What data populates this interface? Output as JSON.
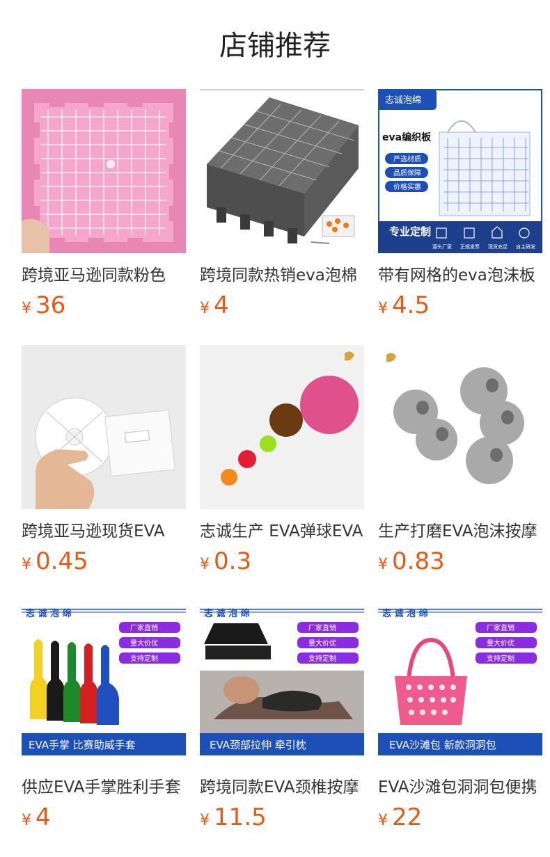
{
  "section_title": "店铺推荐",
  "currency_symbol": "¥",
  "products": [
    {
      "name": "跨境亚马逊同款粉色",
      "price": "36",
      "image": "pink-eva-grid-mat"
    },
    {
      "name": "跨境同款热销eva泡棉",
      "price": "4",
      "image": "gray-eva-blocking-boards"
    },
    {
      "name": "带有网格的eva泡沫板",
      "price": "4.5",
      "image": "eva-knitting-board-ad",
      "image_text": {
        "brand": "志诚泡绵",
        "heading": "eva编织板",
        "tags": [
          "严选材质",
          "品质保障",
          "价格实惠"
        ],
        "banner": "专业定制",
        "icons": [
          "源头厂家",
          "正规发票",
          "现货充足",
          "自主研发"
        ]
      }
    },
    {
      "name": "跨境亚马逊现货EVA",
      "price": "0.45",
      "image": "kumihimo-disc-in-hand"
    },
    {
      "name": "志诚生产 EVA弹球EVA",
      "price": "0.3",
      "image": "eva-foam-balls"
    },
    {
      "name": "生产打磨EVA泡沫按摩",
      "price": "0.83",
      "image": "gray-eva-beads"
    },
    {
      "name": "供应EVA手掌胜利手套",
      "price": "4",
      "image": "eva-foam-fingers",
      "image_text": {
        "brand": "志 诚 泡 绵",
        "tags": [
          "厂家直销",
          "量大价优",
          "支持定制"
        ],
        "banner": "EVA手掌 比赛助威手套"
      }
    },
    {
      "name": "跨境同款EVA颈椎按摩",
      "price": "11.5",
      "image": "eva-neck-stretcher",
      "image_text": {
        "brand": "志 诚 泡 绵",
        "tags": [
          "厂家直销",
          "量大价优",
          "支持定制"
        ],
        "banner": "EVA颈部拉伸 牵引枕"
      }
    },
    {
      "name": "EVA沙滩包洞洞包便携",
      "price": "22",
      "image": "eva-beach-bag",
      "image_text": {
        "brand": "志 诚 泡 绵",
        "tags": [
          "厂家直销",
          "量大价优",
          "支持定制"
        ],
        "banner": "EVA沙滩包 新款洞洞包"
      }
    }
  ]
}
